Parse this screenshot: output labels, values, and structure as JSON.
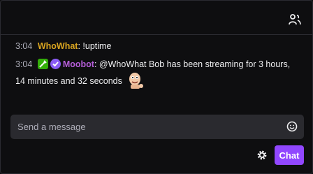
{
  "header": {
    "users_icon": "users-icon"
  },
  "messages": [
    {
      "time": "3:04",
      "username": "WhoWhat",
      "colon": ":",
      "text": "!uptime"
    },
    {
      "time": "3:04",
      "badges": [
        "moderator-badge",
        "verified-badge"
      ],
      "username": "Moobot",
      "colon": ":",
      "text": "@WhoWhat Bob has been streaming for 3 hours, 14 minutes and 32 seconds",
      "emote": "emote"
    }
  ],
  "input": {
    "placeholder": "Send a message",
    "emoji_icon": "smiley-icon"
  },
  "footer": {
    "settings_icon": "gear-icon",
    "chat_label": "Chat"
  },
  "colors": {
    "background": "#0e0e10",
    "accent": "#9147ff",
    "user1": "#daa520",
    "user2": "#b45ed8",
    "mod_badge": "#34ae0a"
  }
}
